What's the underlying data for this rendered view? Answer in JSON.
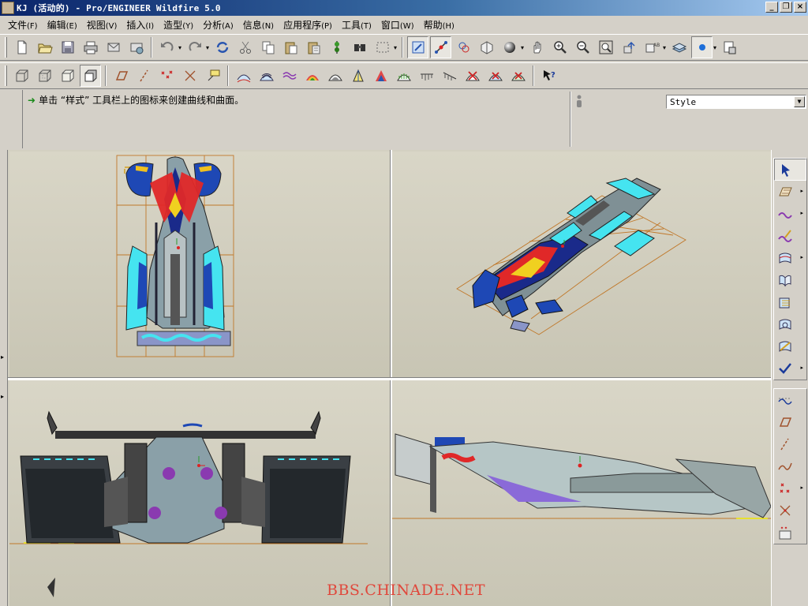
{
  "window": {
    "title": "KJ (活动的) - Pro/ENGINEER Wildfire 5.0",
    "min": "_",
    "restore": "❐",
    "close": "×"
  },
  "menu": [
    {
      "label": "文件",
      "acc": "(F)"
    },
    {
      "label": "编辑",
      "acc": "(E)"
    },
    {
      "label": "视图",
      "acc": "(V)"
    },
    {
      "label": "插入",
      "acc": "(I)"
    },
    {
      "label": "造型",
      "acc": "(Y)"
    },
    {
      "label": "分析",
      "acc": "(A)"
    },
    {
      "label": "信息",
      "acc": "(N)"
    },
    {
      "label": "应用程序",
      "acc": "(P)"
    },
    {
      "label": "工具",
      "acc": "(T)"
    },
    {
      "label": "窗口",
      "acc": "(W)"
    },
    {
      "label": "帮助",
      "acc": "(H)"
    }
  ],
  "message": {
    "text": "单击 “样式” 工具栏上的图标来创建曲线和曲面。"
  },
  "style_select": {
    "value": "Style"
  },
  "watermark": "BBS.CHINADE.NET",
  "toolbar1_icons": [
    "new-icon",
    "open-icon",
    "save-icon",
    "print-icon",
    "send-email-icon",
    "send-link-icon",
    "undo-icon",
    "redo-icon",
    "regenerate-icon",
    "cut-icon",
    "copy-icon",
    "paste-icon",
    "paste-special-icon",
    "traffic-light-icon",
    "find-icon",
    "select-box-icon",
    "repaint-icon",
    "spin-center-icon",
    "orient-icon",
    "view-manager-icon",
    "shading-icon",
    "pan-icon",
    "zoom-in-icon",
    "zoom-out-icon",
    "refit-icon",
    "orient-view-icon",
    "saved-views-icon",
    "layers-icon",
    "display-style-icon",
    "named-view-icon"
  ],
  "toolbar2_icons": [
    "wireframe-icon",
    "hidden-line-icon",
    "no-hidden-icon",
    "shaded-icon",
    "datum-planes-icon",
    "datum-axes-icon",
    "datum-points-icon",
    "csys-icon",
    "annotations-icon",
    "curvature-icon",
    "reflection-icon",
    "section-icon",
    "shaded-curvature-icon",
    "slope-icon",
    "dihedral-icon",
    "draft-icon",
    "deviation-icon",
    "offset-icon",
    "connection-icon",
    "curve-analysis-icon",
    "surface-analysis-icon",
    "delete-analysis-icon",
    "context-help-icon"
  ]
}
